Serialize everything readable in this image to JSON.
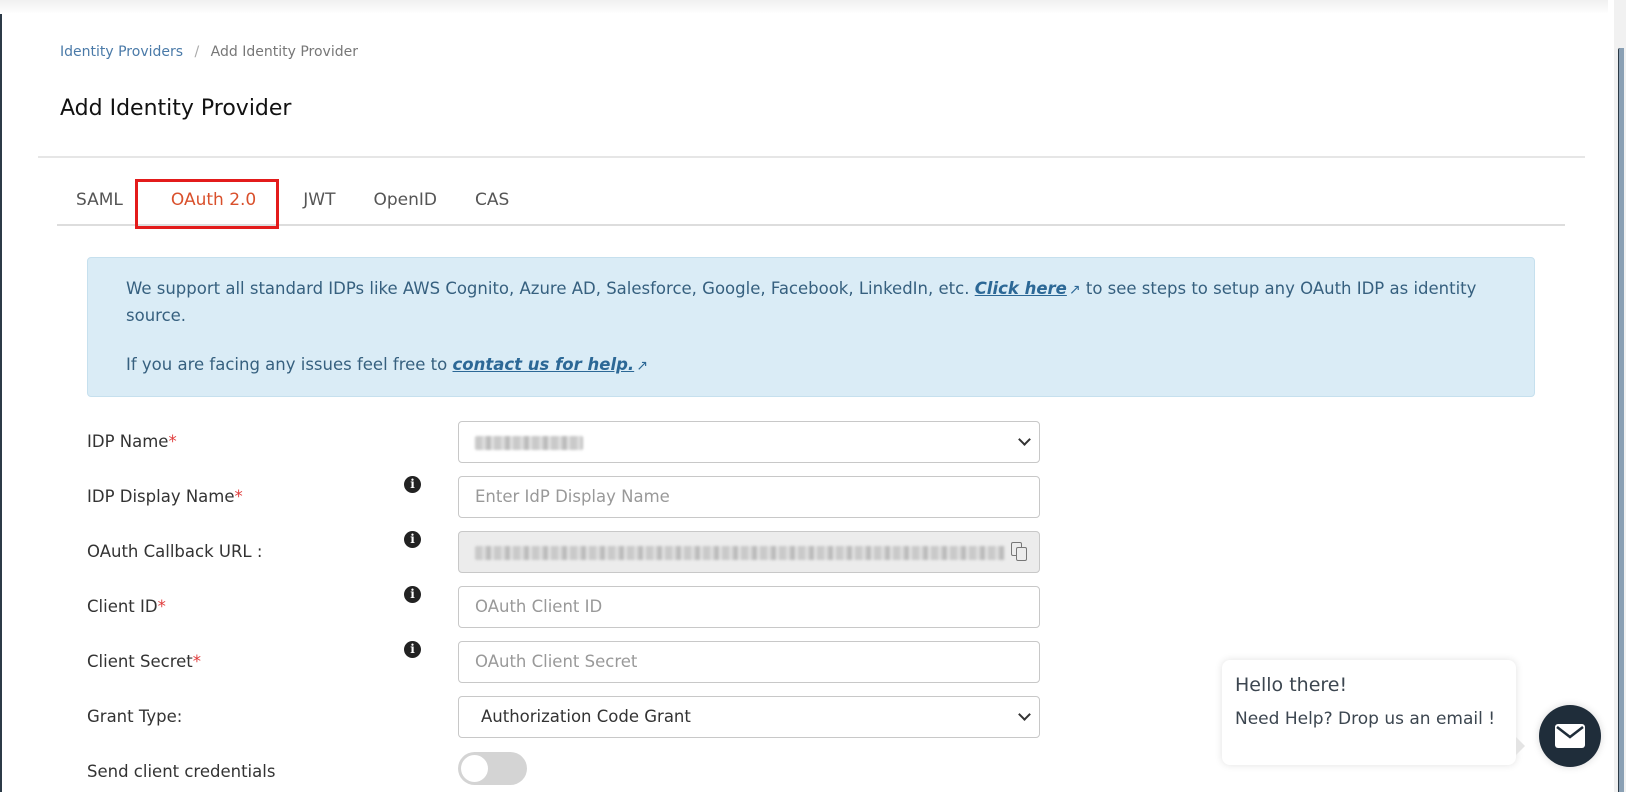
{
  "breadcrumb": {
    "parent": "Identity Providers",
    "separator": "/",
    "current": "Add Identity Provider"
  },
  "page_title": "Add Identity Provider",
  "tabs": [
    {
      "label": "SAML",
      "active": false
    },
    {
      "label": "OAuth 2.0",
      "active": true
    },
    {
      "label": "JWT",
      "active": false
    },
    {
      "label": "OpenID",
      "active": false
    },
    {
      "label": "CAS",
      "active": false
    }
  ],
  "alert": {
    "text1_before": "We support all standard IDPs like AWS Cognito, Azure AD, Salesforce, Google, Facebook, LinkedIn, etc. ",
    "link1": "Click here",
    "text1_after": " to see steps to setup any OAuth IDP as identity source.",
    "text2_before": "If you are facing any issues feel free to ",
    "link2": "contact us for help.",
    "external_icon": "external-link-icon"
  },
  "form": {
    "idp_name": {
      "label": "IDP Name",
      "required": "*",
      "value_blurred": true
    },
    "idp_display_name": {
      "label": "IDP Display Name",
      "required": "*",
      "placeholder": "Enter IdP Display Name"
    },
    "callback_url": {
      "label": "OAuth Callback URL :",
      "value_blurred": true,
      "icon": "copy-icon"
    },
    "client_id": {
      "label": "Client ID",
      "required": "*",
      "placeholder": "OAuth Client ID"
    },
    "client_secret": {
      "label": "Client Secret",
      "required": "*",
      "placeholder": "OAuth Client Secret"
    },
    "grant_type": {
      "label": "Grant Type:",
      "value": "Authorization Code Grant"
    },
    "send_client_credentials": {
      "label": "Send client credentials",
      "enabled": false
    }
  },
  "chat_widget": {
    "greeting": "Hello there!",
    "message": "Need Help? Drop us an email !",
    "button_icon": "mail-icon"
  },
  "colors": {
    "active_tab": "#d9502c",
    "highlight_box": "#e31b1b",
    "alert_bg": "#daecf6",
    "link": "#2c6896",
    "required": "#e03c3c",
    "chat_button": "#1f2d3a"
  }
}
